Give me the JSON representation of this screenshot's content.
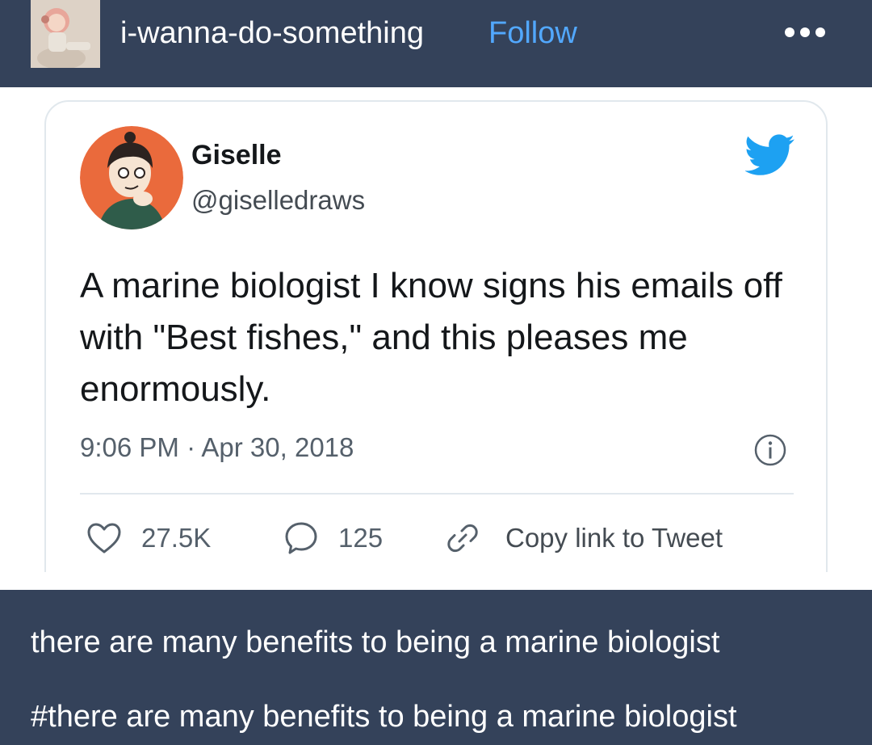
{
  "header": {
    "blog_name": "i-wanna-do-something",
    "follow_label": "Follow",
    "more_icon": "ellipsis-icon"
  },
  "tweet": {
    "author_name": "Giselle",
    "author_handle": "@giselledraws",
    "text": "A marine biologist I know signs his emails off with \"Best fishes,\" and this pleases me enormously.",
    "timestamp": "9:06 PM · Apr 30, 2018",
    "likes": "27.5K",
    "replies": "125",
    "copy_link_label": "Copy link to Tweet",
    "brand_color": "#1da1f2",
    "icons": [
      "twitter-bird-icon",
      "info-icon",
      "heart-icon",
      "comment-icon",
      "link-icon"
    ]
  },
  "post": {
    "caption": "there are many benefits to being a marine biologist",
    "tag": "#there are many benefits to being a marine biologist"
  },
  "colors": {
    "tumblr_background": "#34425a",
    "follow_link": "#52a8ff"
  }
}
